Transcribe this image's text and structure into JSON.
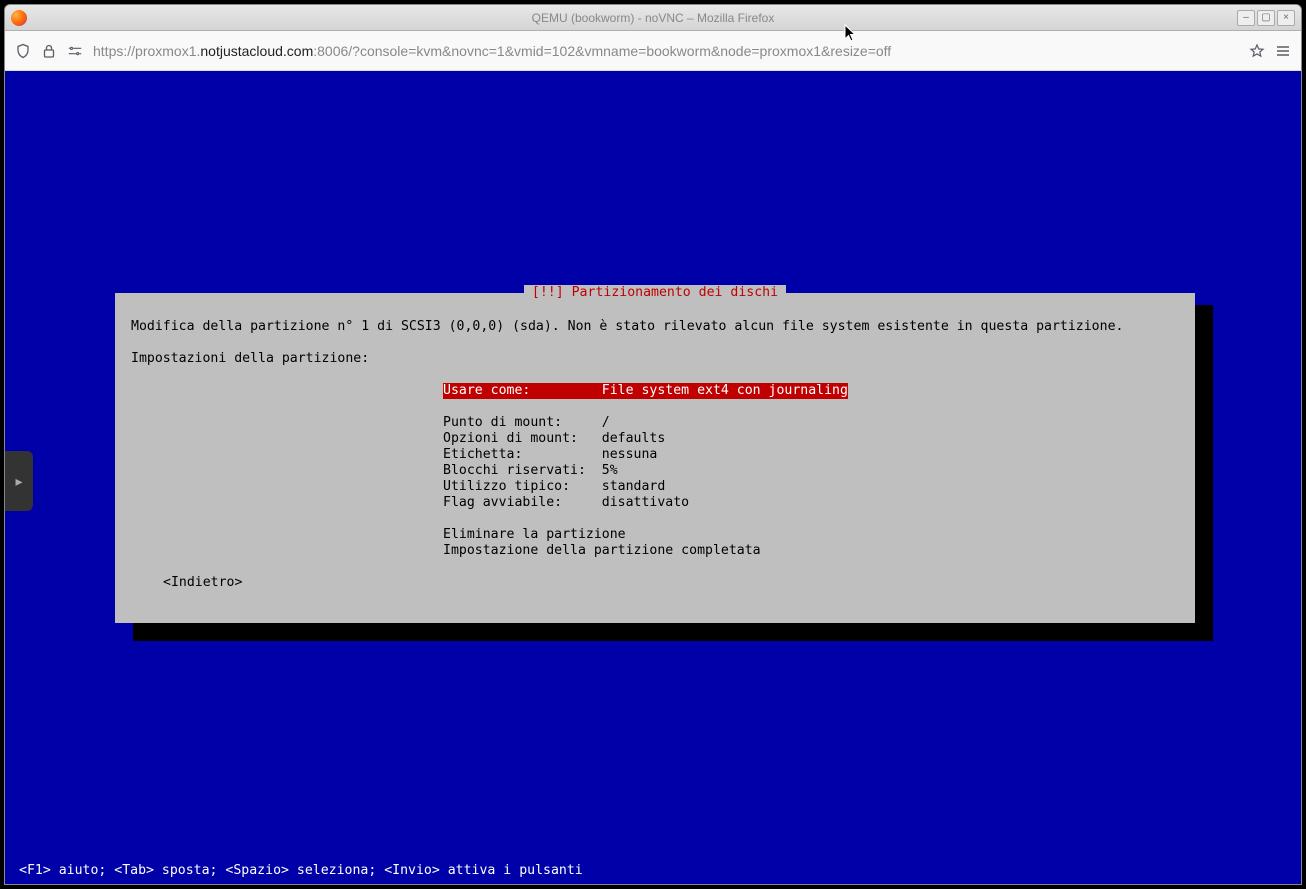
{
  "window": {
    "title": "QEMU (bookworm) - noVNC – Mozilla Firefox"
  },
  "url": {
    "protocol": "https://",
    "host_pre": "proxmox1.",
    "host_dark": "notjustacloud.com",
    "rest": ":8006/?console=kvm&novnc=1&vmid=102&vmname=bookworm&node=proxmox1&resize=off"
  },
  "sidebar": {
    "toggle_glyph": "▸"
  },
  "installer": {
    "title": "[!!] Partizionamento dei dischi",
    "description": "Modifica della partizione n° 1 di SCSI3 (0,0,0) (sda). Non è stato rilevato alcun file system esistente in questa partizione.",
    "settings_header": "Impostazioni della partizione:",
    "rows": {
      "use_as": "Usare come:         File system ext4 con journaling",
      "mount_point": "Punto di mount:     /",
      "mount_opts": "Opzioni di mount:   defaults",
      "label": "Etichetta:          nessuna",
      "reserved": "Blocchi riservati:  5%",
      "typical": "Utilizzo tipico:    standard",
      "bootable": "Flag avviabile:     disattivato",
      "delete": "Eliminare la partizione",
      "done": "Impostazione della partizione completata"
    },
    "back": "<Indietro>"
  },
  "helpline": "<F1> aiuto; <Tab> sposta; <Spazio> seleziona; <Invio> attiva i pulsanti"
}
